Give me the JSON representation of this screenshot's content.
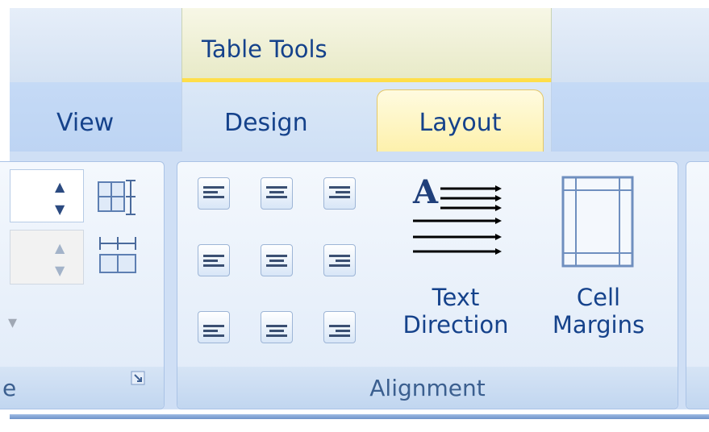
{
  "context_group": {
    "title": "Table Tools"
  },
  "tabs": [
    {
      "label": "View"
    },
    {
      "label": "Design"
    },
    {
      "label": "Layout"
    }
  ],
  "left_group": {
    "label_fragment": "e"
  },
  "alignment_group": {
    "label": "Alignment",
    "buttons": [
      {
        "icon": "align-top-left-icon"
      },
      {
        "icon": "align-top-center-icon"
      },
      {
        "icon": "align-top-right-icon"
      },
      {
        "icon": "align-center-left-icon"
      },
      {
        "icon": "align-center-center-icon"
      },
      {
        "icon": "align-center-right-icon"
      },
      {
        "icon": "align-bottom-left-icon"
      },
      {
        "icon": "align-bottom-center-icon"
      },
      {
        "icon": "align-bottom-right-icon"
      }
    ],
    "text_direction": {
      "line1": "Text",
      "line2": "Direction"
    },
    "cell_margins": {
      "line1": "Cell",
      "line2": "Margins"
    }
  },
  "colors": {
    "accent_text": "#15428b",
    "active_tab": "#fdf0a8",
    "context_strip": "#ffde4a"
  }
}
